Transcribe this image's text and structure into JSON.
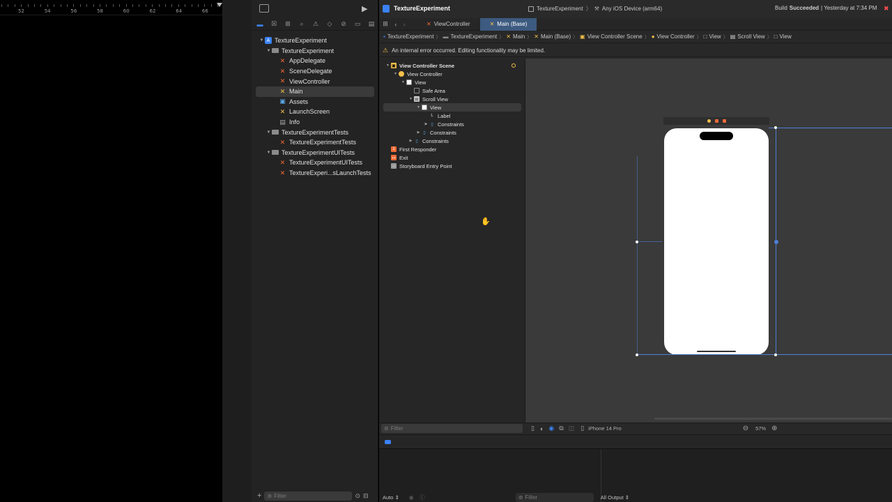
{
  "ruler": {
    "ticks": [
      "52",
      "54",
      "56",
      "58",
      "60",
      "62",
      "64",
      "66"
    ]
  },
  "window": {
    "project_name": "TextureExperiment",
    "scheme": "TextureExperiment",
    "destination": "Any iOS Device (arm64)",
    "status_prefix": "Build",
    "status_bold": "Succeeded",
    "status_suffix": "| Yesterday at 7:34 PM"
  },
  "navigator": {
    "items": [
      {
        "label": "TextureExperiment",
        "kind": "xcproj",
        "level": 0,
        "disclosure": "open"
      },
      {
        "label": "TextureExperiment",
        "kind": "folder",
        "level": 1,
        "disclosure": "open"
      },
      {
        "label": "AppDelegate",
        "kind": "swift",
        "level": 2,
        "disclosure": ""
      },
      {
        "label": "SceneDelegate",
        "kind": "swift",
        "level": 2,
        "disclosure": ""
      },
      {
        "label": "ViewController",
        "kind": "swift",
        "level": 2,
        "disclosure": ""
      },
      {
        "label": "Main",
        "kind": "sb",
        "level": 2,
        "disclosure": "",
        "selected": true
      },
      {
        "label": "Assets",
        "kind": "assets",
        "level": 2,
        "disclosure": ""
      },
      {
        "label": "LaunchScreen",
        "kind": "sb",
        "level": 2,
        "disclosure": ""
      },
      {
        "label": "Info",
        "kind": "plist",
        "level": 2,
        "disclosure": ""
      },
      {
        "label": "TextureExperimentTests",
        "kind": "folder",
        "level": 1,
        "disclosure": "open"
      },
      {
        "label": "TextureExperimentTests",
        "kind": "swift",
        "level": 2,
        "disclosure": ""
      },
      {
        "label": "TextureExperimentUITests",
        "kind": "folder",
        "level": 1,
        "disclosure": "open"
      },
      {
        "label": "TextureExperimentUITests",
        "kind": "swift",
        "level": 2,
        "disclosure": ""
      },
      {
        "label": "TextureExperi...sLaunchTests",
        "kind": "swift",
        "level": 2,
        "disclosure": ""
      }
    ],
    "filter_placeholder": "Filter"
  },
  "tabs": [
    {
      "label": "ViewController",
      "active": false
    },
    {
      "label": "Main (Base)",
      "active": true
    }
  ],
  "jump_bar": [
    "TextureExperiment",
    "TextureExperiment",
    "Main",
    "Main (Base)",
    "View Controller Scene",
    "View Controller",
    "View",
    "Scroll View",
    "View"
  ],
  "warning": "An internal error occurred. Editing functionality may be limited.",
  "outline": {
    "items": [
      {
        "label": "View Controller Scene",
        "level": 0,
        "disclosure": "open",
        "icon": "scene",
        "bold": true
      },
      {
        "label": "View Controller",
        "level": 1,
        "disclosure": "open",
        "icon": "vc"
      },
      {
        "label": "View",
        "level": 2,
        "disclosure": "open",
        "icon": "view"
      },
      {
        "label": "Safe Area",
        "level": 3,
        "disclosure": "",
        "icon": "safe"
      },
      {
        "label": "Scroll View",
        "level": 3,
        "disclosure": "open",
        "icon": "scroll"
      },
      {
        "label": "View",
        "level": 4,
        "disclosure": "open",
        "icon": "view",
        "selected": true
      },
      {
        "label": "Label",
        "level": 5,
        "disclosure": "",
        "icon": "label"
      },
      {
        "label": "Constraints",
        "level": 5,
        "disclosure": "closed",
        "icon": "constraint"
      },
      {
        "label": "Constraints",
        "level": 4,
        "disclosure": "closed",
        "icon": "constraint"
      },
      {
        "label": "Constraints",
        "level": 3,
        "disclosure": "closed",
        "icon": "constraint"
      },
      {
        "label": "First Responder",
        "level": 0,
        "disclosure": "",
        "icon": "responder"
      },
      {
        "label": "Exit",
        "level": 0,
        "disclosure": "",
        "icon": "exit"
      },
      {
        "label": "Storyboard Entry Point",
        "level": 0,
        "disclosure": "",
        "icon": "entry"
      }
    ],
    "filter_placeholder": "Filter"
  },
  "canvas_bar": {
    "device": "iPhone 14 Pro",
    "zoom": "57%"
  },
  "debug": {
    "auto_label": "Auto",
    "filter_placeholder": "Filter",
    "output_label": "All Output"
  },
  "colors": {
    "accent": "#3b82f6",
    "selection": "#4f7fd6",
    "warning": "#f4c04a"
  }
}
